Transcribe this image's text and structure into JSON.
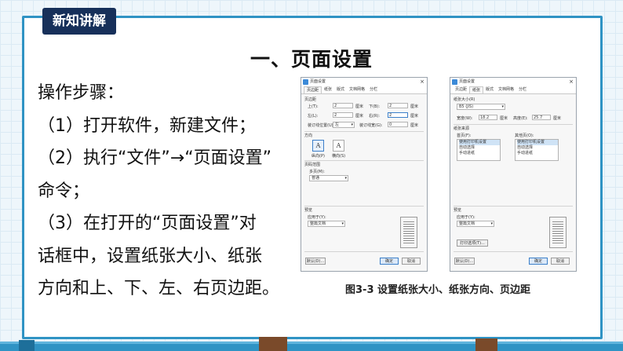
{
  "slide": {
    "badge": "新知讲解",
    "title": "一、页面设置",
    "steps": [
      "操作步骤：",
      "（1）打开软件，新建文件；",
      "（2）执行“文件”→“页面设置”",
      "命令；",
      "（3）在打开的“页面设置”对",
      "话框中，设置纸张大小、纸张",
      "方向和上、下、左、右页边距。"
    ],
    "caption": "图3-3 设置纸张大小、纸张方向、页边距"
  },
  "colors": {
    "frame": "#2f93c4",
    "badge_bg": "#17305a"
  },
  "dialog1": {
    "title": "页面设置",
    "tabs": [
      "页边距",
      "纸张",
      "版式",
      "文档网格",
      "分栏"
    ],
    "margins_label": "页边距",
    "top_label": "上(T):",
    "top_value": "2",
    "top_unit": "厘米",
    "bottom_label": "下(B):",
    "bottom_value": "2",
    "bottom_unit": "厘米",
    "left_label": "左(L):",
    "left_value": "2",
    "left_unit": "厘米",
    "right_label": "右(R):",
    "right_value": "2",
    "right_unit": "厘米",
    "gutter_label": "装订线位置(U):",
    "gutter_value": "左",
    "gutter_width_label": "装订线宽(G):",
    "gutter_width_value": "0",
    "gutter_width_unit": "厘米",
    "orientation_label": "方向",
    "portrait_label": "纵向(P)",
    "landscape_label": "横向(S)",
    "pages_label": "页码范围",
    "multi_label": "多页(M):",
    "multi_value": "普通",
    "preview_label": "预览",
    "apply_label": "应用于(Y):",
    "apply_value": "整篇文档",
    "default_btn": "默认(D)...",
    "ok_btn": "确定",
    "cancel_btn": "取消"
  },
  "dialog2": {
    "title": "页面设置",
    "tabs": [
      "页边距",
      "纸张",
      "版式",
      "文档网格",
      "分栏"
    ],
    "size_label": "纸张大小(R)",
    "size_value": "B5 (JIS)",
    "width_label": "宽度(W):",
    "width_value": "18.2",
    "width_unit": "厘米",
    "height_label": "高度(E):",
    "height_value": "25.7",
    "height_unit": "厘米",
    "source_label": "纸张来源",
    "first_label": "首页(F):",
    "other_label": "其他页(O):",
    "first_items": [
      "使用打印机设置",
      "自动选择",
      "手动进纸"
    ],
    "other_items": [
      "使用打印机设置",
      "自动选择",
      "手动进纸"
    ],
    "preview_label": "预览",
    "apply_label": "应用于(Y):",
    "apply_value": "整篇文档",
    "print_btn": "打印选项(T)...",
    "default_btn": "默认(D)...",
    "ok_btn": "确定",
    "cancel_btn": "取消"
  }
}
